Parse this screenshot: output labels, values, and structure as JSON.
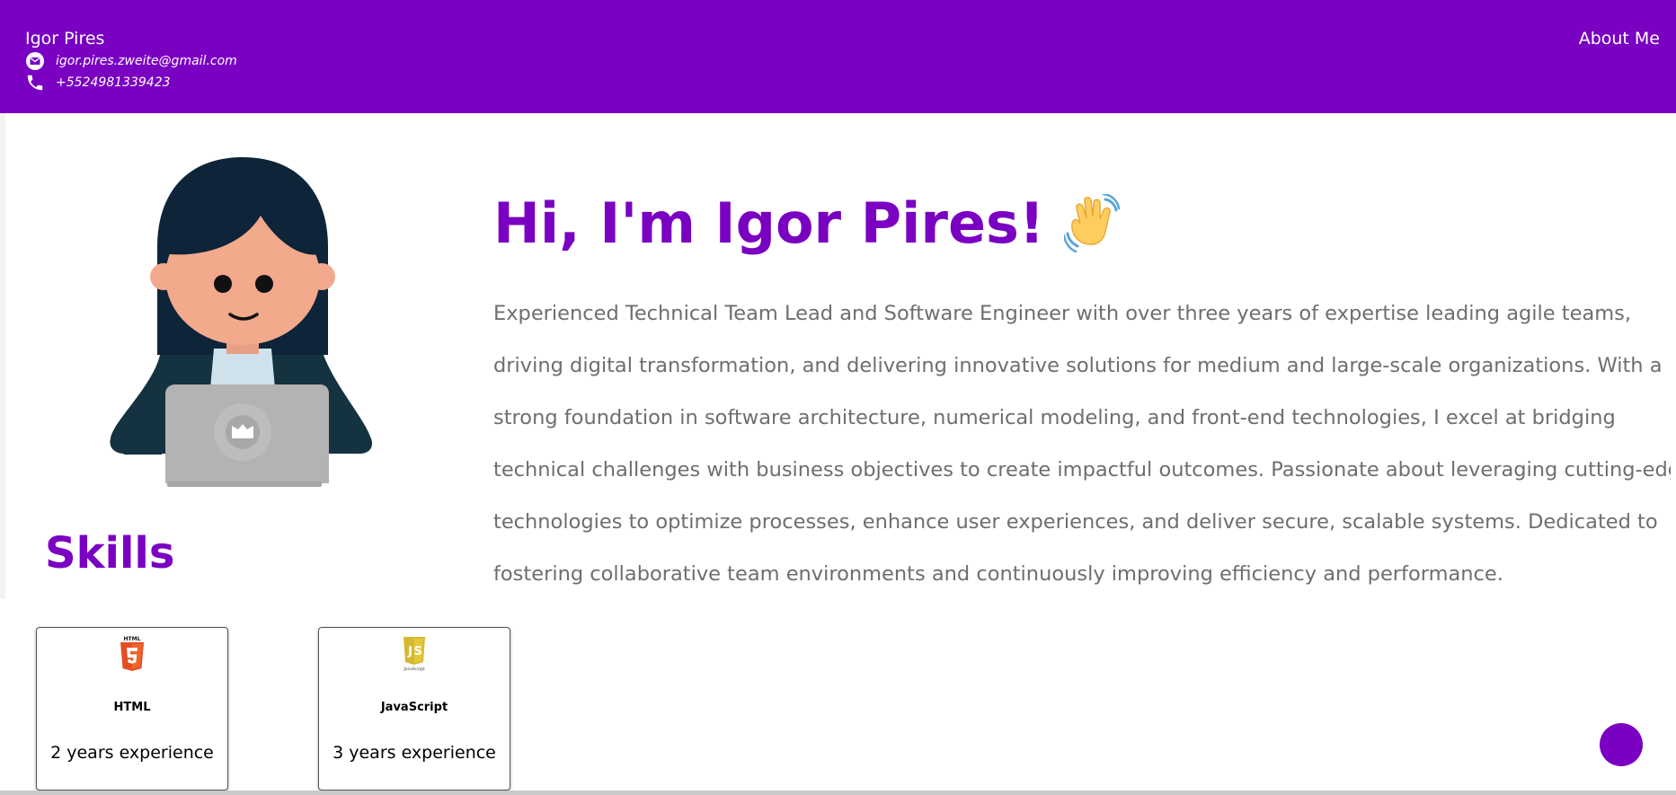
{
  "header": {
    "name": "Igor Pires",
    "email": "igor.pires.zweite@gmail.com",
    "phone": "+5524981339423",
    "nav_about": "About Me",
    "icons": {
      "email": "envelope-icon",
      "phone": "phone-icon"
    },
    "background_color": "#7a00c2"
  },
  "hero": {
    "title": "Hi, I'm Igor Pires!",
    "emoji": "waving-hand-icon",
    "bio_lines": [
      "Experienced Technical Team Lead and Software Engineer with over three years of expertise leading agile teams,",
      "driving digital transformation, and delivering innovative solutions for medium and large-scale organizations. With a",
      "strong foundation in software architecture, numerical modeling, and front-end technologies, I excel at bridging",
      "technical challenges with business objectives to create impactful outcomes. Passionate about leveraging cutting-edge",
      "technologies to optimize processes, enhance user experiences, and deliver secure, scalable systems. Dedicated to",
      "fostering collaborative team environments and continuously improving efficiency and performance."
    ],
    "avatar": "developer-avatar-illustration"
  },
  "skills": {
    "heading": "Skills",
    "items": [
      {
        "name": "HTML",
        "experience": "2 years experience",
        "logo": "html5-logo-icon",
        "logo_label": "HTML"
      },
      {
        "name": "JavaScript",
        "experience": "3 years experience",
        "logo": "javascript-logo-icon",
        "logo_label": "JavaScript"
      }
    ]
  },
  "fab": {
    "color": "#7a00c2"
  },
  "colors": {
    "accent": "#7a00c2",
    "bio_text": "#6e6e6e"
  }
}
